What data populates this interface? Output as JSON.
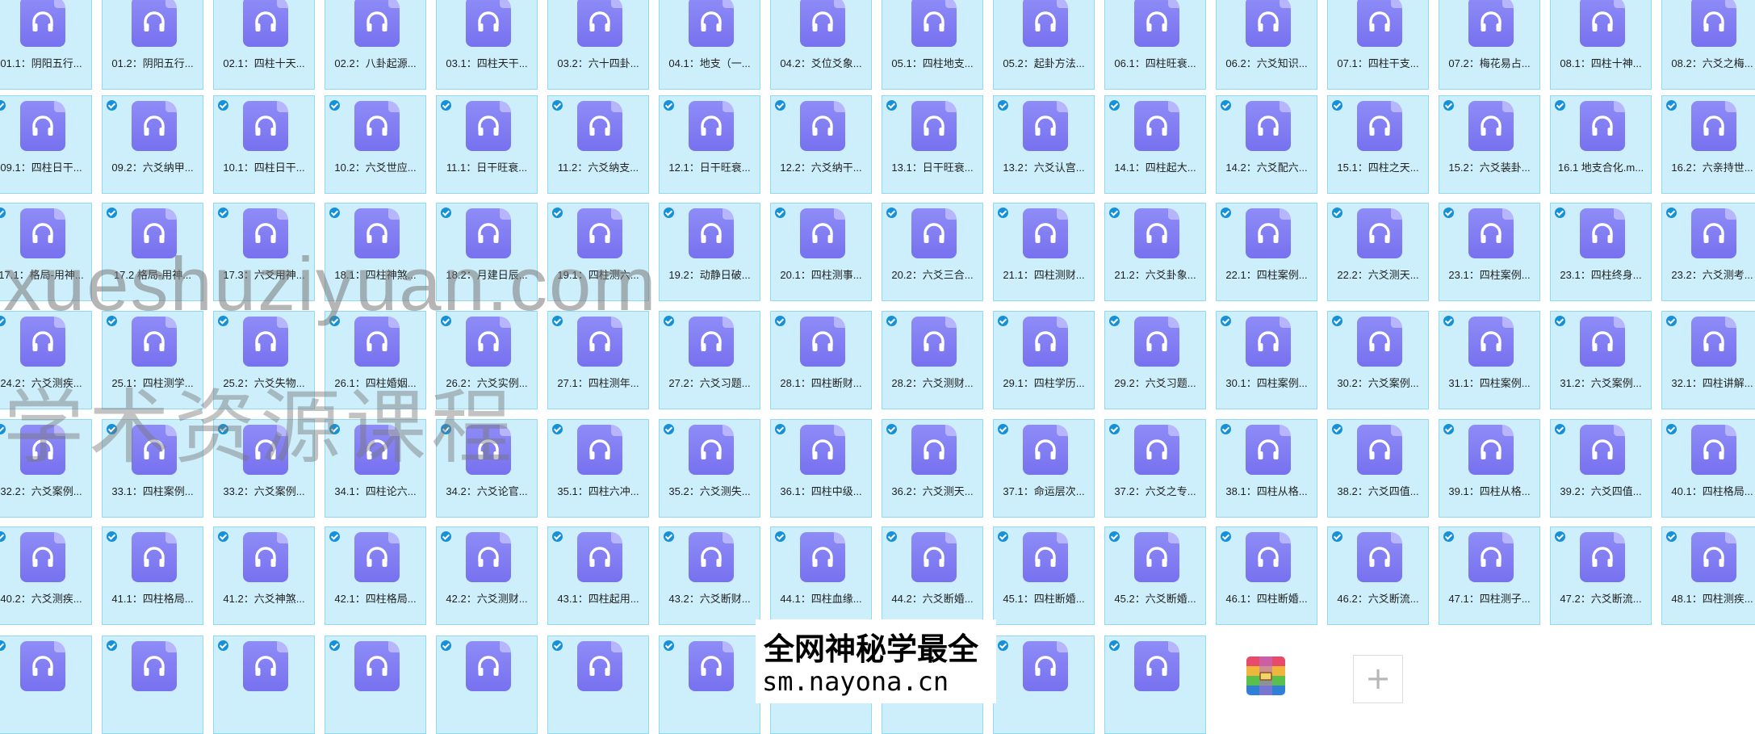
{
  "rows": [
    {
      "checked": false,
      "labels": [
        "01.1：阴阳五行...",
        "01.2：阴阳五行...",
        "02.1：四柱十天...",
        "02.2：八卦起源...",
        "03.1：四柱天干...",
        "03.2：六十四卦...",
        "04.1：地支（一...",
        "04.2：爻位爻象...",
        "05.1：四柱地支...",
        "05.2：起卦方法...",
        "06.1：四柱旺衰...",
        "06.2：六爻知识...",
        "07.1：四柱干支...",
        "07.2：梅花易占...",
        "08.1：四柱十神...",
        "08.2：六爻之梅..."
      ]
    },
    {
      "checked": true,
      "labels": [
        "09.1：四柱日干...",
        "09.2：六爻纳甲...",
        "10.1：四柱日干...",
        "10.2：六爻世应...",
        "11.1：日干旺衰...",
        "11.2：六爻纳支...",
        "12.1：日干旺衰...",
        "12.2：六爻纳干...",
        "13.1：日干旺衰...",
        "13.2：六爻认宫...",
        "14.1：四柱起大...",
        "14.2：六爻配六...",
        "15.1：四柱之天...",
        "15.2：六爻装卦...",
        "16.1 地支合化.m...",
        "16.2：六亲持世..."
      ]
    },
    {
      "checked": true,
      "labels": [
        "17.1：格局-用神...",
        "17.2 格局-用神...",
        "17.3：六爻用神...",
        "18.1：四柱神煞...",
        "18.2：月建日辰...",
        "19.1：四柱测六...",
        "19.2：动静日破...",
        "20.1：四柱测事...",
        "20.2：六爻三合...",
        "21.1：四柱测财...",
        "21.2：六爻卦象...",
        "22.1：四柱案例...",
        "22.2：六爻测天...",
        "23.1：四柱案例...",
        "23.1：四柱终身...",
        "23.2：六爻测考..."
      ]
    },
    {
      "checked": true,
      "labels": [
        "24.2：六爻测疾...",
        "25.1：四柱测学...",
        "25.2：六爻失物...",
        "26.1：四柱婚姻...",
        "26.2：六爻实例...",
        "27.1：四柱测年...",
        "27.2：六爻习题...",
        "28.1：四柱断财...",
        "28.2：六爻测财...",
        "29.1：四柱学历...",
        "29.2：六爻习题...",
        "30.1：四柱案例...",
        "30.2：六爻案例...",
        "31.1：四柱案例...",
        "31.2：六爻案例...",
        "32.1：四柱讲解..."
      ]
    },
    {
      "checked": true,
      "labels": [
        "32.2：六爻案例...",
        "33.1：四柱案例...",
        "33.2：六爻案例...",
        "34.1：四柱论六...",
        "34.2：六爻论官...",
        "35.1：四柱六冲...",
        "35.2：六爻测失...",
        "36.1：四柱中级...",
        "36.2：六爻测天...",
        "37.1：命运层次...",
        "37.2：六爻之专...",
        "38.1：四柱从格...",
        "38.2：六爻四值...",
        "39.1：四柱从格...",
        "39.2：六爻四值...",
        "40.1：四柱格局..."
      ]
    },
    {
      "checked": true,
      "labels": [
        "40.2：六爻测疾...",
        "41.1：四柱格局...",
        "41.2：六爻神煞...",
        "42.1：四柱格局...",
        "42.2：六爻测财...",
        "43.1：四柱起用...",
        "43.2：六爻断财...",
        "44.1：四柱血缘...",
        "44.2：六爻断婚...",
        "45.1：四柱断婚...",
        "45.2：六爻断婚...",
        "46.1：四柱断婚...",
        "46.2：六爻断流...",
        "47.1：四柱测子...",
        "47.2：六爻断流...",
        "48.1：四柱测疾..."
      ]
    },
    {
      "checked": true,
      "labels": [
        "",
        "",
        "",
        "",
        "",
        "",
        "",
        "",
        "",
        "",
        "",
        "",
        "",
        "",
        "",
        ""
      ]
    }
  ],
  "watermark": {
    "url": "xueshuziyuan.com",
    "text": "学术资源课程"
  },
  "banner": {
    "line1": "全网神秘学最全",
    "line2": "sm.nayona.cn"
  },
  "last_row_file_count": 11,
  "add_button": {
    "label": "+"
  },
  "colors": {
    "tile_bg": "#cdeffb",
    "tile_border": "#8fd9f1",
    "icon": "#7d79f2",
    "check": "#1690d6"
  }
}
